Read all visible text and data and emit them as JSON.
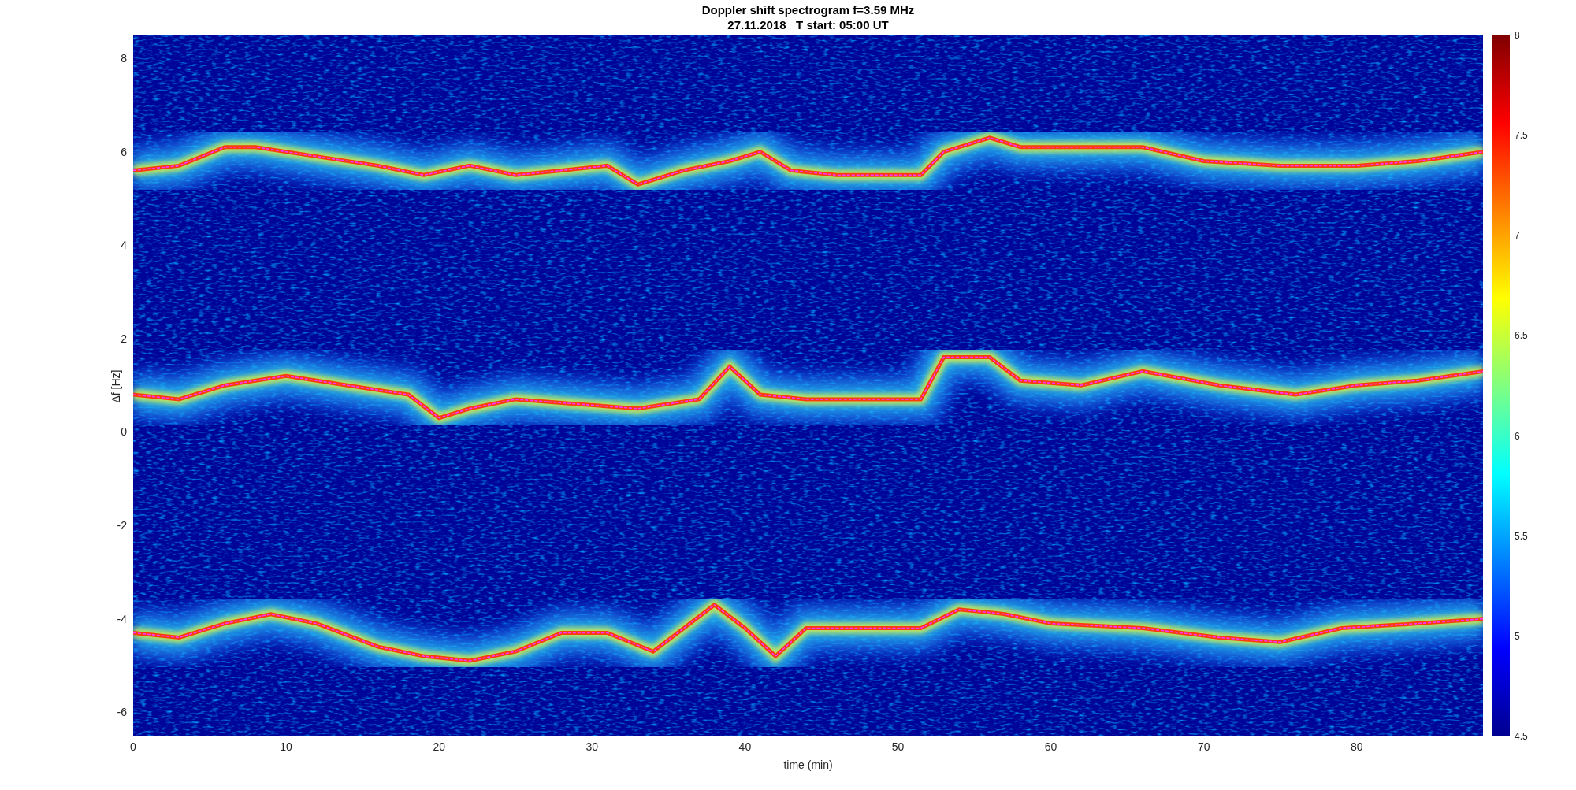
{
  "title": [
    "Doppler shift spectrogram f=3.59 MHz",
    "27.11.2018   T start: 05:00 UT"
  ],
  "y_axis": {
    "label": "Δf [Hz]",
    "ticks": [
      "8",
      "6",
      "4",
      "2",
      "0",
      "-2",
      "-4",
      "-6"
    ]
  },
  "x_axis": {
    "label": "time (min)",
    "ticks": [
      "0",
      "10",
      "20",
      "30",
      "40",
      "50",
      "60",
      "70",
      "80"
    ]
  },
  "colorbar": {
    "ticks": [
      "8",
      "7.5",
      "7",
      "6.5",
      "6",
      "5.5",
      "5",
      "4.5"
    ]
  }
}
